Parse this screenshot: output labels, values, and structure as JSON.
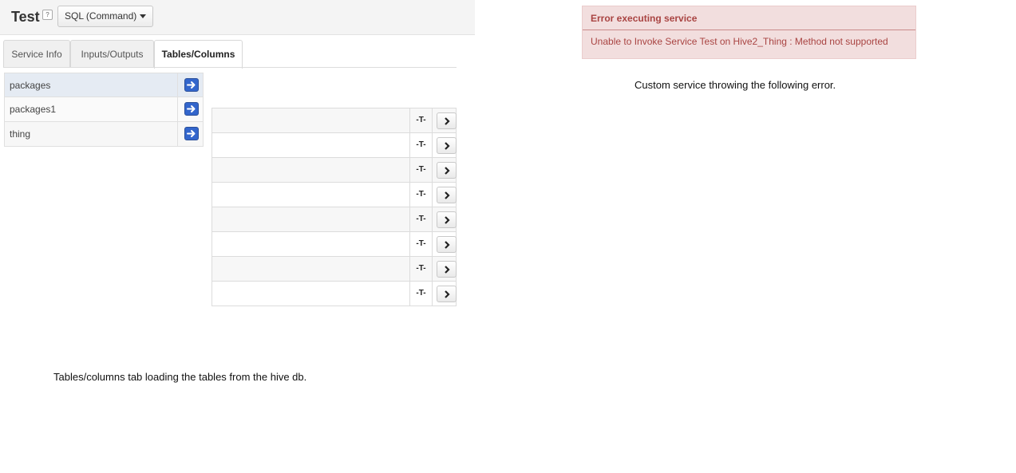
{
  "header": {
    "title": "Test",
    "help_label": "?",
    "type_dropdown": "SQL (Command)"
  },
  "tabs": [
    {
      "label": "Service Info",
      "active": false
    },
    {
      "label": "Inputs/Outputs",
      "active": false
    },
    {
      "label": "Tables/Columns",
      "active": true
    }
  ],
  "tables": [
    {
      "name": "packages",
      "selected": true
    },
    {
      "name": "packages1",
      "selected": false
    },
    {
      "name": "thing",
      "selected": false
    }
  ],
  "columns": {
    "type_glyph": "-T-",
    "row_count": 8
  },
  "captions": {
    "left": "Tables/columns tab loading the tables from the hive db.",
    "right": "Custom service throwing the following error."
  },
  "error": {
    "title": "Error executing service",
    "message": "Unable to Invoke Service Test on Hive2_Thing : Method not supported"
  },
  "colors": {
    "error_bg": "#f2dede",
    "error_text": "#a94442",
    "accent_blue": "#3366cc",
    "selected_row": "#e5ebf3"
  }
}
